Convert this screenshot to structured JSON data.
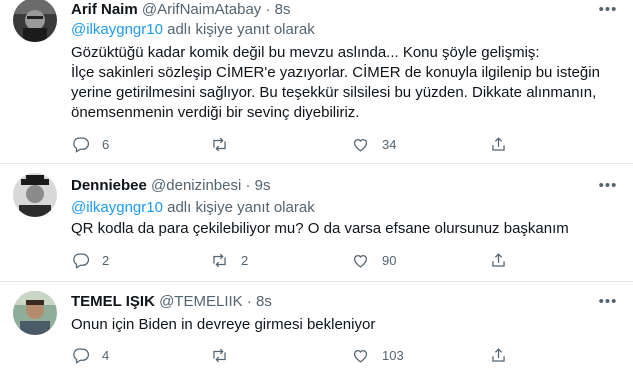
{
  "reply_label": "adlı kişiye yanıt olarak",
  "tweets": [
    {
      "name": "Arif Naim",
      "handle": "@ArifNaimAtabay",
      "dot": "·",
      "time": "8s",
      "mention": "@ilkaygngr10",
      "lines": [
        "Gözüktüğü kadar komik değil bu mevzu aslında... Konu şöyle gelişmiş:",
        "İlçe sakinleri sözleşip CİMER'e yazıyorlar. CİMER de konuyla ilgilenip bu isteğin",
        "yerine getirilmesini sağlıyor. Bu teşekkür silsilesi bu yüzden. Dikkate alınmanın,",
        "önemsenmenin verdiği bir sevinç diyebiliriz."
      ],
      "replies": "6",
      "retweets": "",
      "likes": "34"
    },
    {
      "name": "Denniebee",
      "handle": "@denizinbesi",
      "dot": "·",
      "time": "9s",
      "mention": "@ilkaygngr10",
      "lines": [
        "QR kodla da para çekilebiliyor mu? O da varsa efsane olursunuz başkanım"
      ],
      "replies": "2",
      "retweets": "2",
      "likes": "90"
    },
    {
      "name": "TEMEL IŞIK",
      "handle": "@TEMELIIK",
      "dot": "·",
      "time": "8s",
      "lines": [
        "Onun için Biden in devreye girmesi bekleniyor"
      ],
      "replies": "4",
      "retweets": "",
      "likes": "103"
    }
  ],
  "icons": {
    "more": "more-horizontal-icon",
    "reply": "reply-icon",
    "retweet": "retweet-icon",
    "like": "heart-icon",
    "share": "share-icon"
  },
  "colors": {
    "link": "#1d9bf0",
    "secondary_text": "#536471",
    "divider": "#e7e9ea"
  }
}
